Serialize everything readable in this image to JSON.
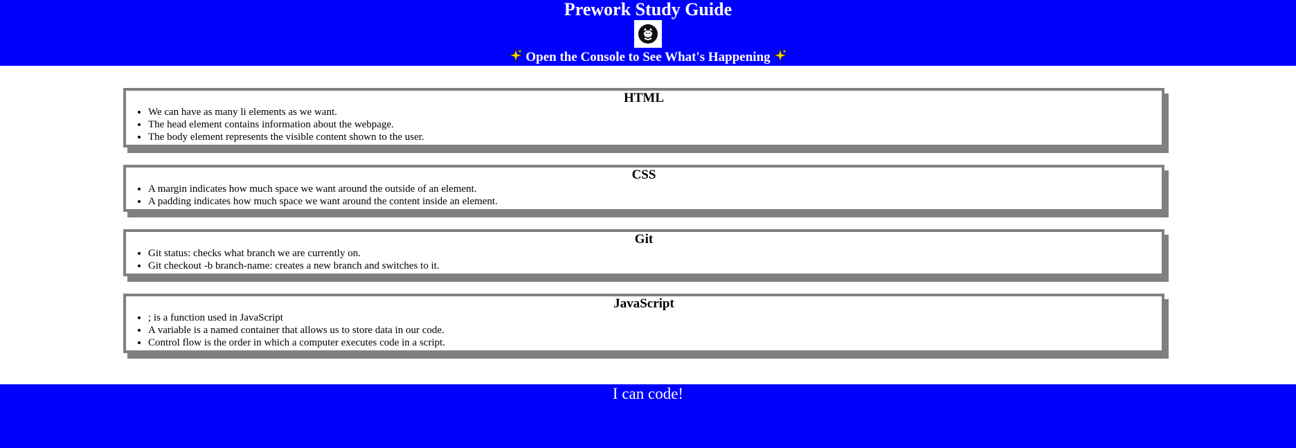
{
  "header": {
    "title": "Prework Study Guide",
    "logo_icon": "cat-logo-icon",
    "subtitle": "Open the Console to See What's Happening",
    "sparkle_icon": "sparkles-icon",
    "background": "#0000ff"
  },
  "sections": [
    {
      "title": "HTML",
      "items": [
        "We can have as many li elements as we want.",
        "The head element contains information about the webpage.",
        "The body element represents the visible content shown to the user."
      ]
    },
    {
      "title": "CSS",
      "items": [
        "A margin indicates how much space we want around the outside of an element.",
        "A padding indicates how much space we want around the content inside an element."
      ]
    },
    {
      "title": "Git",
      "items": [
        "Git status: checks what branch we are currently on.",
        "Git checkout -b branch-name: creates a new branch and switches to it."
      ]
    },
    {
      "title": "JavaScript",
      "items": [
        "; is a function used in JavaScript",
        "A variable is a named container that allows us to store data in our code.",
        "Control flow is the order in which a computer executes code in a script."
      ]
    }
  ],
  "footer": {
    "text": "I can code!"
  }
}
